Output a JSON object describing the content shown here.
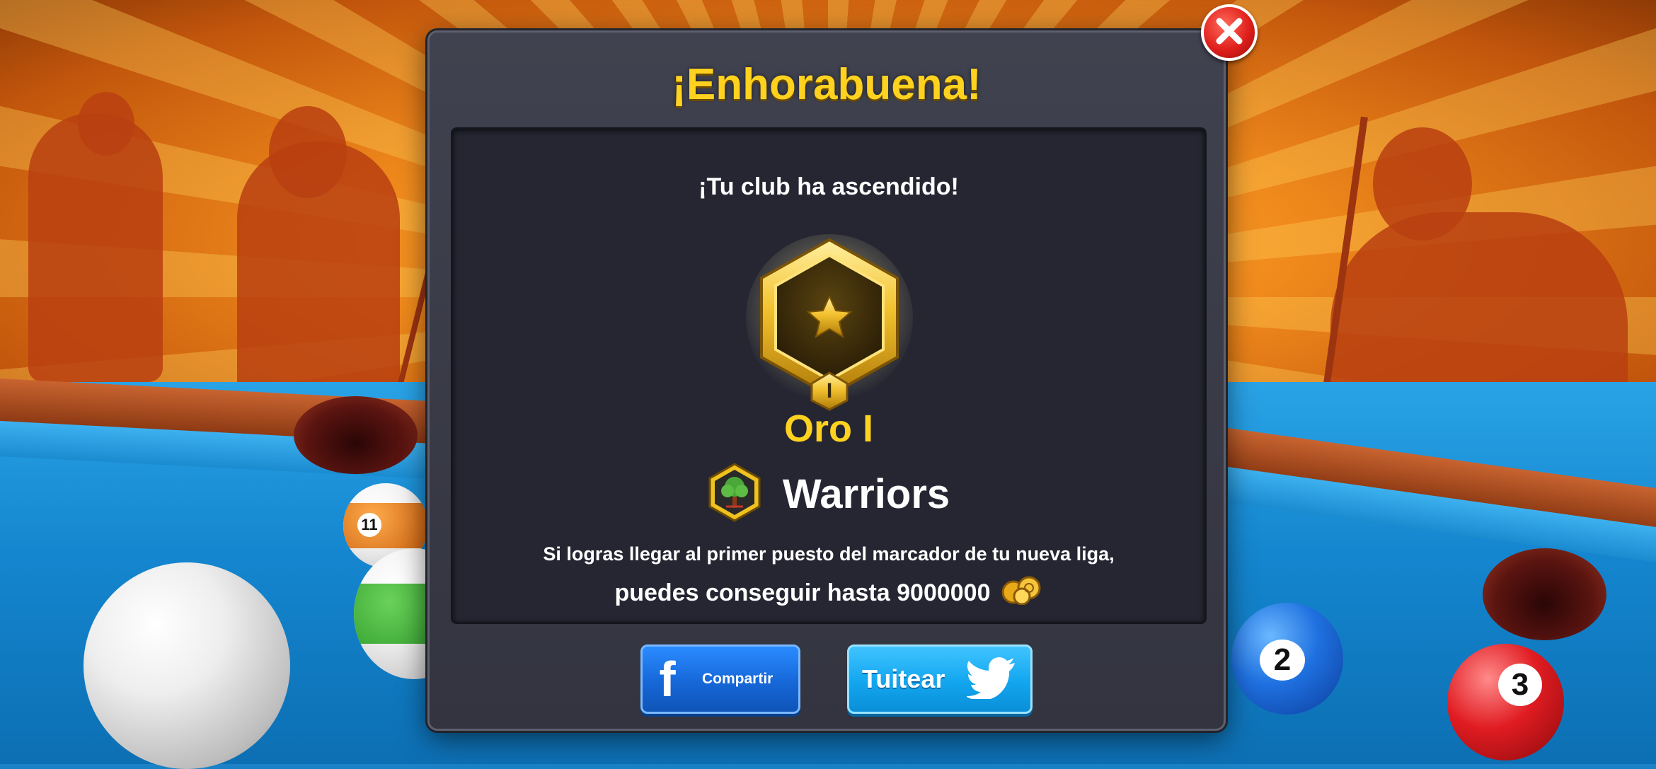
{
  "dialog": {
    "title": "¡Enhorabuena!",
    "subtitle": "¡Tu club ha ascendido!",
    "league_name": "Oro I",
    "league_badge_numeral": "I",
    "club_name": "Warriors",
    "reward_line1": "Si logras llegar al primer puesto del marcador de tu nueva liga,",
    "reward_line2": "puedes conseguir hasta 9000000",
    "reward_icon": "coins-icon",
    "buttons": {
      "facebook_letter": "f",
      "share_label": "Compartir",
      "tweet_label": "Tuitear"
    },
    "close_icon": "close-icon"
  },
  "background": {
    "balls": [
      "11",
      "2",
      "3"
    ]
  },
  "colors": {
    "title_gold": "#ffd21f",
    "panel_bg": "#252632",
    "dialog_bg": "#3a3b47",
    "facebook_blue": "#1667d8",
    "twitter_blue": "#12a6ef",
    "close_red": "#e0201c"
  }
}
